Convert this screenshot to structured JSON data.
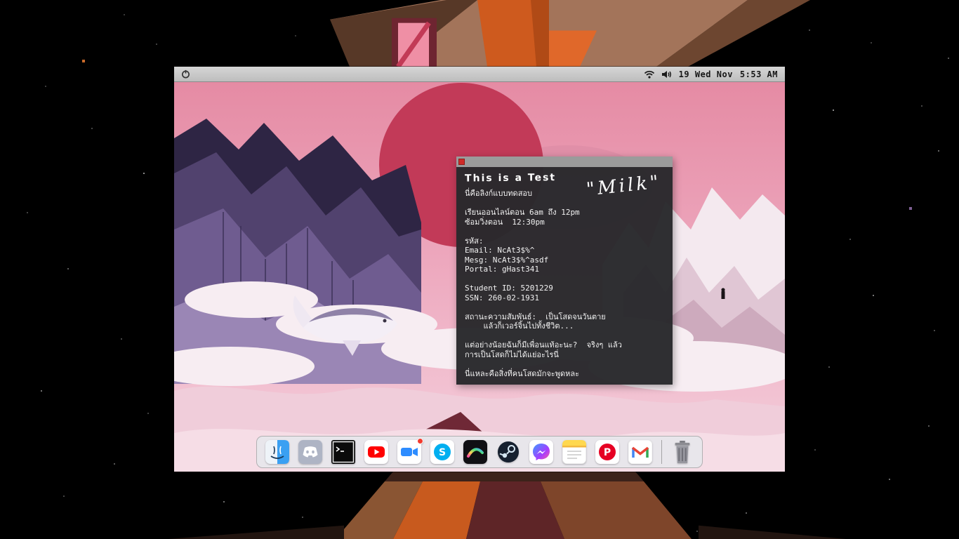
{
  "scene": {
    "accent_colors": {
      "room_orange": "#ce5a1e",
      "room_brown": "#a3745a",
      "sky_pink": "#eda7bd",
      "sun_red": "#c23a58"
    }
  },
  "menu_bar": {
    "power_icon": "power-icon",
    "status_icons": [
      "wifi-icon",
      "volume-icon"
    ],
    "date": "19 Wed Nov",
    "time": "5:53 AM"
  },
  "window": {
    "title": "This is a Test",
    "handwriting_note": "\"Milk\"",
    "lines": [
      "นี่คือลิงก์แบบทดสอบ",
      "",
      "เรียนออนไลน์ตอน 6am ถึง 12pm",
      "ซ้อมวิ่งตอน  12:30pm",
      "",
      "รหัส:",
      "Email: NcAt3$%^",
      "Mesg: NcAt3$%^asdf",
      "Portal: gHast341",
      "",
      "Student ID: 5201229",
      "SSN: 260-02-1931",
      "",
      "สถานะความสัมพันธ์:  เป็นโสดจนวันตาย",
      "    แล้วก็เวอร์จิ้นไปทั้งชีวิต...",
      "",
      "แต่อย่างน้อยฉันก็มีเพื่อนแท้อะนะ?  จริงๆ แล้ว",
      "การเป็นโสดก็ไม่ได้แย่อะไรนี่",
      "",
      "นี่แหละคือสิ่งที่คนโสดมักจะพูดหละ"
    ]
  },
  "dock": {
    "items": [
      {
        "id": "finder",
        "label": "Finder"
      },
      {
        "id": "discord",
        "label": "Discord"
      },
      {
        "id": "terminal",
        "label": "Terminal"
      },
      {
        "id": "youtube",
        "label": "YouTube"
      },
      {
        "id": "zoom",
        "label": "Camera",
        "badge": true
      },
      {
        "id": "skype",
        "label": "Skype"
      },
      {
        "id": "paint",
        "label": "Paint"
      },
      {
        "id": "steam",
        "label": "Steam"
      },
      {
        "id": "messenger",
        "label": "Messenger"
      },
      {
        "id": "notes",
        "label": "Notes"
      },
      {
        "id": "pinterest",
        "label": "Pinterest"
      },
      {
        "id": "gmail",
        "label": "Gmail"
      },
      {
        "id": "trash",
        "label": "Trash",
        "separated": true
      }
    ]
  }
}
